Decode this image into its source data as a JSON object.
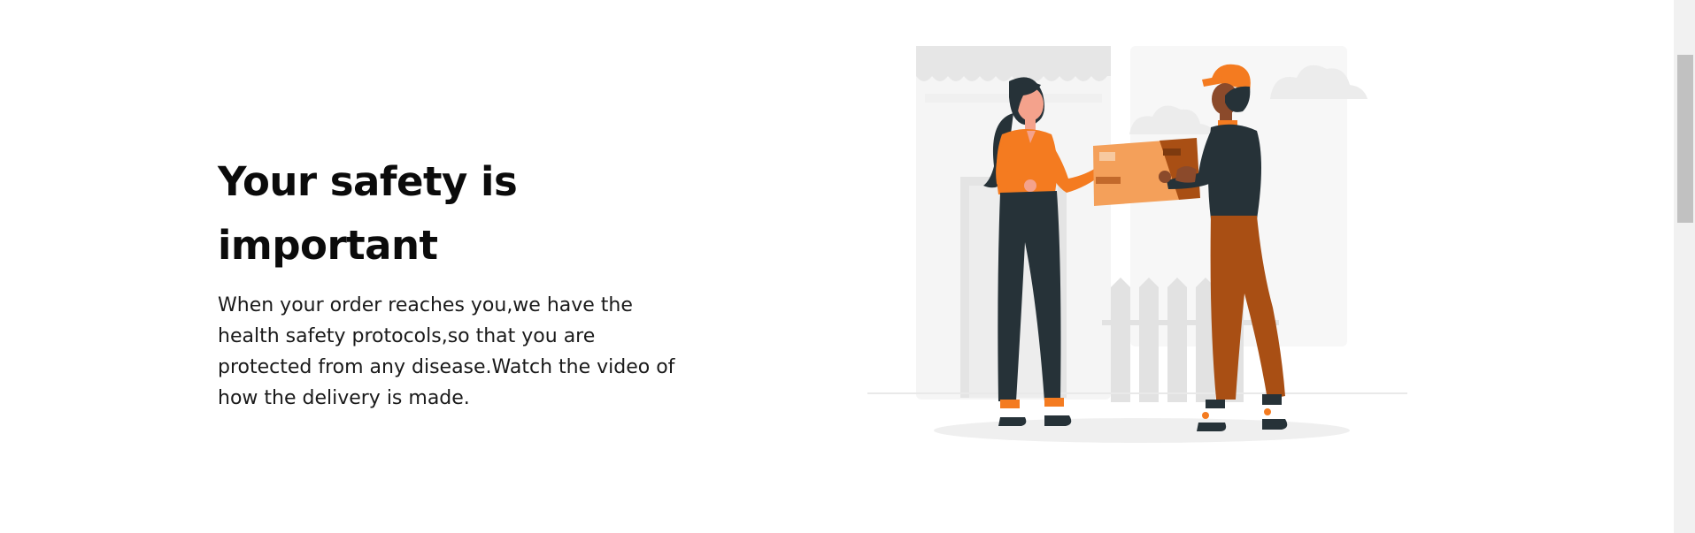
{
  "section": {
    "headline": "Your safety is important",
    "description": "When your order reaches you,we have the health safety protocols,so that you are protected from any disease.Watch the video of how the delivery is made."
  },
  "illustration": {
    "subject": "delivery-handoff",
    "colors": {
      "accent": "#f47b20",
      "accent_light": "#f4a05a",
      "dark": "#263238",
      "rust": "#a94f14",
      "background_gray": "#ebebeb",
      "skin_light": "#f4a28c",
      "skin_dark": "#8b4a2b"
    }
  }
}
